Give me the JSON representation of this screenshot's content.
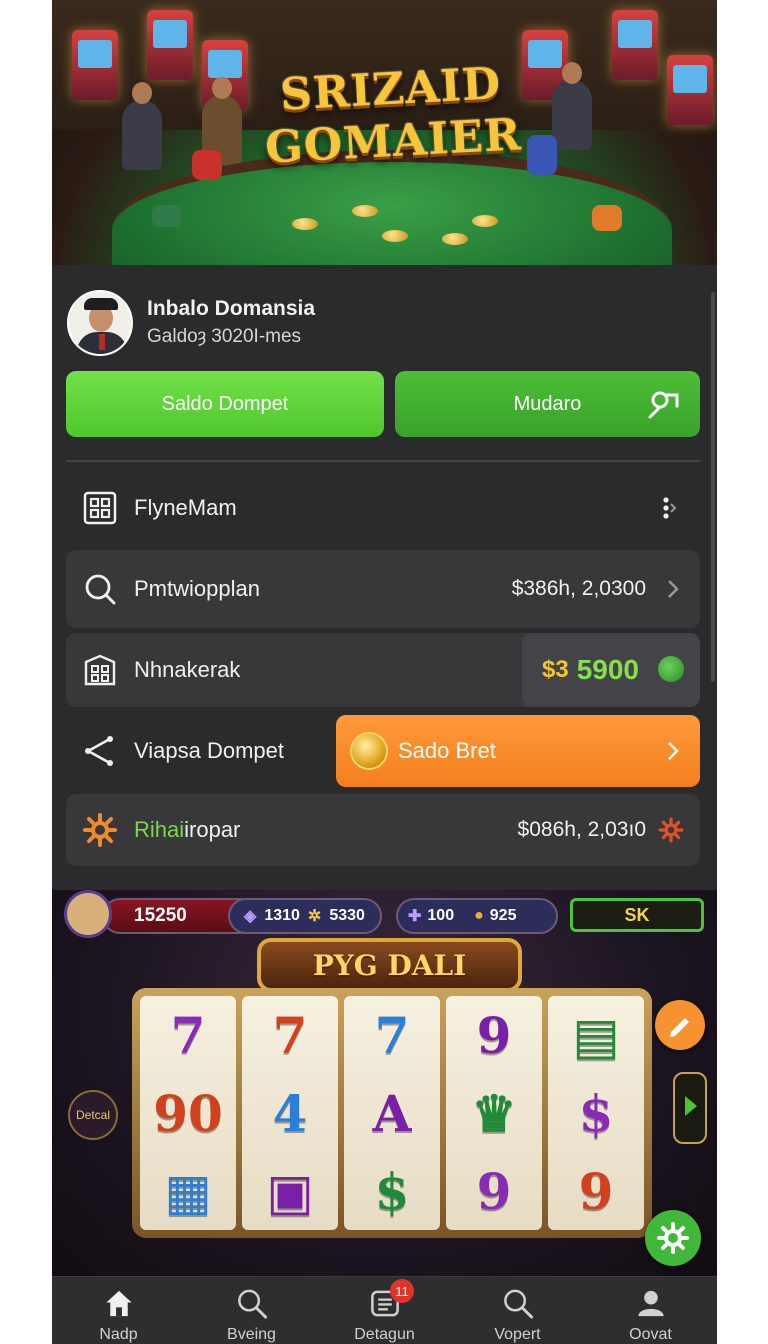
{
  "banner": {
    "logo_line1": "SRIZAID",
    "logo_line2": "GOMAIER"
  },
  "profile": {
    "name": "Inbalo Domansia",
    "subtitle": "Galdoȝ 3020I-mes"
  },
  "actions": {
    "wallet_label": "Saldo Dompet",
    "change_label": "Mudaro"
  },
  "menu": {
    "row1": {
      "label": "FlyneMam",
      "icon": "grid-icon"
    },
    "row2": {
      "label": "Pmtwiopplan",
      "value": "$386h, 2,0300",
      "icon": "search-icon"
    },
    "row3": {
      "label": "Nhnakerak",
      "currency": "$3",
      "amount": "5900",
      "icon": "building-icon"
    },
    "row4": {
      "label": "Viapsa Dompet",
      "button_label": "Sado Bret",
      "icon": "share-icon"
    },
    "row5": {
      "label_green": "Rihai",
      "label_rest": "iropar",
      "value": "$086h, 2,03ı0",
      "icon": "gear-icon"
    }
  },
  "game": {
    "score": "15250",
    "gems": [
      "1310",
      "5330"
    ],
    "tickets": [
      "100",
      "925"
    ],
    "sk": "SK",
    "title": "PYG DALI",
    "side_label": "Detcal",
    "reels": [
      [
        "7",
        "90",
        "▦"
      ],
      [
        "7",
        "4",
        "▣"
      ],
      [
        "7",
        "A",
        "$"
      ],
      [
        "9",
        "♛",
        "9"
      ],
      [
        "▤",
        "$",
        "9"
      ]
    ]
  },
  "nav": {
    "items": [
      {
        "label": "Nadp",
        "icon": "home-icon"
      },
      {
        "label": "Bveing",
        "icon": "search-icon"
      },
      {
        "label": "Detagun",
        "icon": "list-icon",
        "badge": "11"
      },
      {
        "label": "Vopert",
        "icon": "search-icon"
      },
      {
        "label": "Oovat",
        "icon": "user-icon"
      }
    ]
  },
  "colors": {
    "accent_green": "#5fd336",
    "accent_orange": "#f68a2a",
    "surface": "#2b2b2d",
    "card": "#38383b"
  }
}
